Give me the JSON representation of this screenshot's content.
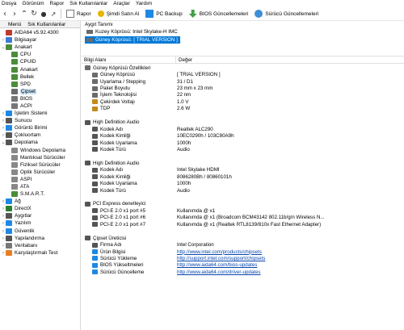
{
  "menu": [
    "Dosya",
    "Görünüm",
    "Rapor",
    "Sık Kullanılanlar",
    "Araçlar",
    "Yardım"
  ],
  "toolbar": {
    "rapor": "Rapor",
    "simdi_satin_al": "Şimdi Satın Al",
    "pc_backup": "PC Backup",
    "bios_guncellemeleri": "BIOS Güncellemeleri",
    "surucu_guncellemeleri": "Sürücü Güncellemeleri"
  },
  "left": {
    "tab_menu": "Menü",
    "tab_favs": "Sık Kullanılanlar",
    "tree": [
      {
        "label": "AIDA64 v5.92.4300",
        "level": 0,
        "exp": "",
        "icon": "aida64-icon",
        "color": "#c0392b"
      },
      {
        "label": "Bilgisayar",
        "level": 1,
        "exp": ">",
        "icon": "computer-icon",
        "color": "#3a7bd5"
      },
      {
        "label": "Anakart",
        "level": 1,
        "exp": "v",
        "icon": "motherboard-icon",
        "color": "#4a8c3a"
      },
      {
        "label": "CPU",
        "level": 2,
        "exp": "",
        "icon": "cpu-icon",
        "color": "#4a8c3a"
      },
      {
        "label": "CPUID",
        "level": 2,
        "exp": "",
        "icon": "cpuid-icon",
        "color": "#4a8c3a"
      },
      {
        "label": "Anakart",
        "level": 2,
        "exp": "",
        "icon": "motherboard-icon",
        "color": "#4a8c3a"
      },
      {
        "label": "Bellek",
        "level": 2,
        "exp": "",
        "icon": "memory-icon",
        "color": "#4a8c3a"
      },
      {
        "label": "SPD",
        "level": 2,
        "exp": "",
        "icon": "spd-icon",
        "color": "#4a8c3a"
      },
      {
        "label": "Çipset",
        "level": 2,
        "exp": "",
        "icon": "chipset-icon",
        "color": "#6b6b6b",
        "selected": true
      },
      {
        "label": "BIOS",
        "level": 2,
        "exp": "",
        "icon": "bios-icon",
        "color": "#777777"
      },
      {
        "label": "ACPI",
        "level": 2,
        "exp": "",
        "icon": "acpi-icon",
        "color": "#777777"
      },
      {
        "label": "İşletim Sistemi",
        "level": 1,
        "exp": ">",
        "icon": "windows-icon",
        "color": "#1e88e5"
      },
      {
        "label": "Sunucu",
        "level": 1,
        "exp": ">",
        "icon": "server-icon",
        "color": "#555555"
      },
      {
        "label": "Görüntü Birimi",
        "level": 1,
        "exp": ">",
        "icon": "display-icon",
        "color": "#1e88e5"
      },
      {
        "label": "Çokluortam",
        "level": 1,
        "exp": ">",
        "icon": "multimedia-icon",
        "color": "#555555"
      },
      {
        "label": "Depolama",
        "level": 1,
        "exp": "v",
        "icon": "storage-icon",
        "color": "#555555"
      },
      {
        "label": "Windows Depolama",
        "level": 2,
        "exp": "",
        "icon": "windows-storage-icon",
        "color": "#888888"
      },
      {
        "label": "Mantıksal Sürücüler",
        "level": 2,
        "exp": "",
        "icon": "logical-drive-icon",
        "color": "#888888"
      },
      {
        "label": "Fiziksel Sürücüler",
        "level": 2,
        "exp": "",
        "icon": "physical-drive-icon",
        "color": "#888888"
      },
      {
        "label": "Optik Sürücüler",
        "level": 2,
        "exp": "",
        "icon": "optical-drive-icon",
        "color": "#888888"
      },
      {
        "label": "ASPI",
        "level": 2,
        "exp": "",
        "icon": "aspi-icon",
        "color": "#888888"
      },
      {
        "label": "ATA",
        "level": 2,
        "exp": "",
        "icon": "ata-icon",
        "color": "#888888"
      },
      {
        "label": "S.M.A.R.T.",
        "level": 2,
        "exp": "",
        "icon": "smart-icon",
        "color": "#4a8c3a"
      },
      {
        "label": "Ağ",
        "level": 1,
        "exp": ">",
        "icon": "network-icon",
        "color": "#1e88e5"
      },
      {
        "label": "DirectX",
        "level": 1,
        "exp": ">",
        "icon": "directx-icon",
        "color": "#2e7d32"
      },
      {
        "label": "Aygıtlar",
        "level": 1,
        "exp": ">",
        "icon": "devices-icon",
        "color": "#555555"
      },
      {
        "label": "Yazılım",
        "level": 1,
        "exp": ">",
        "icon": "software-icon",
        "color": "#1e88e5"
      },
      {
        "label": "Güvenlik",
        "level": 1,
        "exp": ">",
        "icon": "security-icon",
        "color": "#1e88e5"
      },
      {
        "label": "Yapılandırma",
        "level": 1,
        "exp": ">",
        "icon": "config-icon",
        "color": "#555555"
      },
      {
        "label": "Veritabanı",
        "level": 1,
        "exp": ">",
        "icon": "database-icon",
        "color": "#777777"
      },
      {
        "label": "Karşılaştırmalı Test",
        "level": 1,
        "exp": ">",
        "icon": "benchmark-icon",
        "color": "#e67e22"
      }
    ]
  },
  "right": {
    "device_header": "Aygıt Tanımı",
    "devices": [
      {
        "label": "Kuzey Köprüsü: Intel Skylake-H IMC",
        "selected": false
      },
      {
        "label": "Güney Köprüsü: [ TRIAL VERSION ]",
        "selected": true
      }
    ],
    "col_field": "Bilgi Alanı",
    "col_value": "Değer",
    "rows": [
      {
        "type": "group",
        "k": "Güney Köprüsü Özellikleri",
        "v": "",
        "icon": "chipset-icon",
        "color": "#6b6b6b"
      },
      {
        "type": "item",
        "k": "Güney Köprüsü",
        "v": "[ TRIAL VERSION ]",
        "icon": "chipset-icon",
        "color": "#6b6b6b"
      },
      {
        "type": "item",
        "k": "Uyarlama / Stepping",
        "v": "31 / D1",
        "icon": "chipset-icon",
        "color": "#6b6b6b"
      },
      {
        "type": "item",
        "k": "Paket Boyutu",
        "v": "23 mm x 23 mm",
        "icon": "chipset-icon",
        "color": "#6b6b6b"
      },
      {
        "type": "item",
        "k": "İşlem Teknolojisi",
        "v": "22 nm",
        "icon": "chipset-icon",
        "color": "#6b6b6b"
      },
      {
        "type": "item",
        "k": "Çekirdek Voltajı",
        "v": "1.0 V",
        "icon": "voltage-icon",
        "color": "#c48a1a"
      },
      {
        "type": "item",
        "k": "TDP",
        "v": "2.6 W",
        "icon": "tdp-icon",
        "color": "#c48a1a"
      },
      {
        "type": "blank",
        "k": "",
        "v": ""
      },
      {
        "type": "group",
        "k": "High Definition Audio",
        "v": "",
        "icon": "audio-icon",
        "color": "#555555"
      },
      {
        "type": "item",
        "k": "Kodek Adı",
        "v": "Realtek ALC290",
        "icon": "audio-icon",
        "color": "#555555"
      },
      {
        "type": "item",
        "k": "Kodek Kimliği",
        "v": "10EC0290h / 103C80A9h",
        "icon": "audio-icon",
        "color": "#555555"
      },
      {
        "type": "item",
        "k": "Kodek Uyarlama",
        "v": "1000h",
        "icon": "audio-icon",
        "color": "#555555"
      },
      {
        "type": "item",
        "k": "Kodek Türü",
        "v": "Audio",
        "icon": "audio-icon",
        "color": "#555555"
      },
      {
        "type": "blank",
        "k": "",
        "v": ""
      },
      {
        "type": "group",
        "k": "High Definition Audio",
        "v": "",
        "icon": "audio-icon",
        "color": "#555555"
      },
      {
        "type": "item",
        "k": "Kodek Adı",
        "v": "Intel Skylake HDMI",
        "icon": "audio-icon",
        "color": "#555555"
      },
      {
        "type": "item",
        "k": "Kodek Kimliği",
        "v": "8086280Bh / 80860101h",
        "icon": "audio-icon",
        "color": "#555555"
      },
      {
        "type": "item",
        "k": "Kodek Uyarlama",
        "v": "1000h",
        "icon": "audio-icon",
        "color": "#555555"
      },
      {
        "type": "item",
        "k": "Kodek Türü",
        "v": "Audio",
        "icon": "audio-icon",
        "color": "#555555"
      },
      {
        "type": "blank",
        "k": "",
        "v": ""
      },
      {
        "type": "group",
        "k": "PCI Express denetleyici",
        "v": "",
        "icon": "pcie-icon",
        "color": "#555555"
      },
      {
        "type": "item",
        "k": "PCI-E 2.0 x1 port #5",
        "v": "Kullanımda @ x1",
        "icon": "pcie-icon",
        "color": "#555555"
      },
      {
        "type": "item",
        "k": "PCI-E 2.0 x1 port #6",
        "v": "Kullanımda @ x1  (Broadcom BCM43142 802.11b/g/n Wireless N...",
        "icon": "pcie-icon",
        "color": "#555555"
      },
      {
        "type": "item",
        "k": "PCI-E 2.0 x1 port #7",
        "v": "Kullanımda @ x1  (Realtek RTL8139/810x Fast Ethernet Adapter)",
        "icon": "pcie-icon",
        "color": "#555555"
      },
      {
        "type": "blank",
        "k": "",
        "v": ""
      },
      {
        "type": "group",
        "k": "Çipset Üreticisi",
        "v": "",
        "icon": "manufacturer-icon",
        "color": "#555555"
      },
      {
        "type": "item",
        "k": "Firma Adı",
        "v": "Intel Corporation",
        "icon": "company-icon",
        "color": "#555555"
      },
      {
        "type": "item",
        "k": "Ürün Bilgisi",
        "v": "http://www.intel.com/products/chipsets",
        "icon": "product-info-icon",
        "color": "#1e88e5",
        "link": true
      },
      {
        "type": "item",
        "k": "Sürücü Yükleme",
        "v": "http://support.intel.com/support/chipsets",
        "icon": "driver-download-icon",
        "color": "#1e88e5",
        "link": true
      },
      {
        "type": "item",
        "k": "BIOS Yükseltmeleri",
        "v": "http://www.aida64.com/bios-updates",
        "icon": "bios-update-icon",
        "color": "#1e88e5",
        "link": true
      },
      {
        "type": "item",
        "k": "Sürücü Güncelleme",
        "v": "http://www.aida64.com/driver-updates",
        "icon": "driver-update-icon",
        "color": "#1e88e5",
        "link": true
      }
    ]
  },
  "colors": {
    "selection": "#0078d7",
    "link": "#0645ad",
    "tree_select": "#cce4f7"
  }
}
